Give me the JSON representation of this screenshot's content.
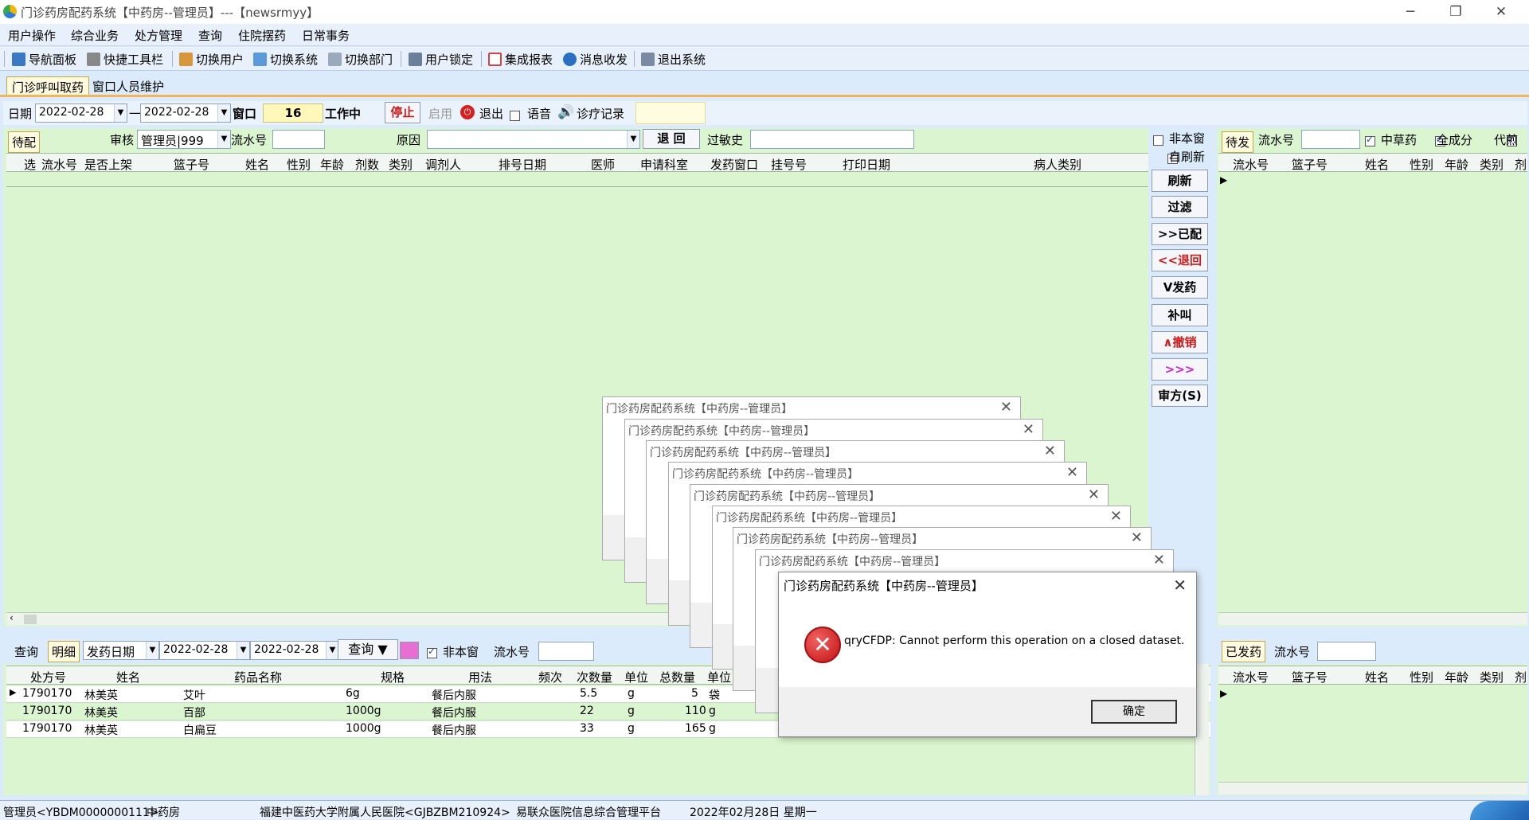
{
  "window": {
    "title": "门诊药房配药系统【中药房--管理员】---【newsrmyy】"
  },
  "menu": [
    "用户操作",
    "综合业务",
    "处方管理",
    "查询",
    "住院摆药",
    "日常事务"
  ],
  "toolbar": [
    "导航面板",
    "快捷工具栏",
    "切换用户",
    "切换系统",
    "切换部门",
    "用户锁定",
    "集成报表",
    "消息收发",
    "退出系统"
  ],
  "tabs": [
    "门诊呼叫取药",
    "窗口人员维护"
  ],
  "filter": {
    "date_label": "日期",
    "date_from": "2022-02-28",
    "dash": "一",
    "date_to": "2022-02-28",
    "window_label": "窗口",
    "window_no": "16",
    "working": "工作中",
    "stop": "停止",
    "enable": "启用",
    "exit": "退出",
    "voice": "语音",
    "records": "诊疗记录"
  },
  "left_grid": {
    "tab": "待配",
    "audit_label": "审核",
    "audit_value": "管理员|999",
    "serial_label": "流水号",
    "reason_label": "原因",
    "back_button": "退 回",
    "allergy_label": "过敏史",
    "columns": [
      "选",
      "流水号",
      "是否上架",
      "篮子号",
      "姓名",
      "性别",
      "年龄",
      "剂数",
      "类别",
      "调剂人",
      "排号日期",
      "医师",
      "申请科室",
      "发药窗口",
      "挂号号",
      "打印日期",
      "病人类别"
    ]
  },
  "side": {
    "non_window": "非本窗",
    "auto_refresh": "自刷新",
    "buttons": [
      "刷新",
      "过滤",
      ">>已配",
      "<<退回",
      "V发药",
      "补叫",
      "∧撤销",
      ">>>",
      "审方(S)"
    ]
  },
  "right_top": {
    "tab": "待发",
    "serial_label": "流水号",
    "chk1": "中草药",
    "chk2": "全成分",
    "chk3": "代煎",
    "columns": [
      "流水号",
      "篮子号",
      "姓名",
      "性别",
      "年龄",
      "类别",
      "剂"
    ]
  },
  "right_bottom": {
    "tab": "已发药",
    "serial_label": "流水号",
    "columns": [
      "流水号",
      "篮子号",
      "姓名",
      "性别",
      "年龄",
      "类别",
      "剂"
    ]
  },
  "bottom": {
    "tab_query": "查询",
    "tab_detail": "明细",
    "date_type": "发药日期",
    "date_from": "2022-02-28",
    "date_to": "2022-02-28",
    "query_button": "查询",
    "non_window": "非本窗",
    "serial_label": "流水号",
    "columns": [
      "处方号",
      "姓名",
      "药品名称",
      "规格",
      "用法",
      "频次",
      "次数量",
      "单位",
      "总数量",
      "单位"
    ],
    "rows": [
      [
        "1790170",
        "林美英",
        "艾叶",
        "6g",
        "餐后内服",
        "",
        "5.5",
        "g",
        "5",
        "袋"
      ],
      [
        "1790170",
        "林美英",
        "百部",
        "1000g",
        "餐后内服",
        "",
        "22",
        "g",
        "110",
        "g"
      ],
      [
        "1790170",
        "林美英",
        "白扁豆",
        "1000g",
        "餐后内服",
        "",
        "33",
        "g",
        "165",
        "g"
      ]
    ]
  },
  "dialog": {
    "title": "门诊药房配药系统【中药房--管理员】",
    "message": "qryCFDP: Cannot perform this operation on a closed dataset.",
    "ok": "确定"
  },
  "status": [
    "管理员<YBDM0000000111>",
    "中药房",
    "福建中医药大学附属人民医院<GJBZBM210924>",
    "易联众医院信息综合管理平台",
    "2022年02月28日 星期一"
  ]
}
